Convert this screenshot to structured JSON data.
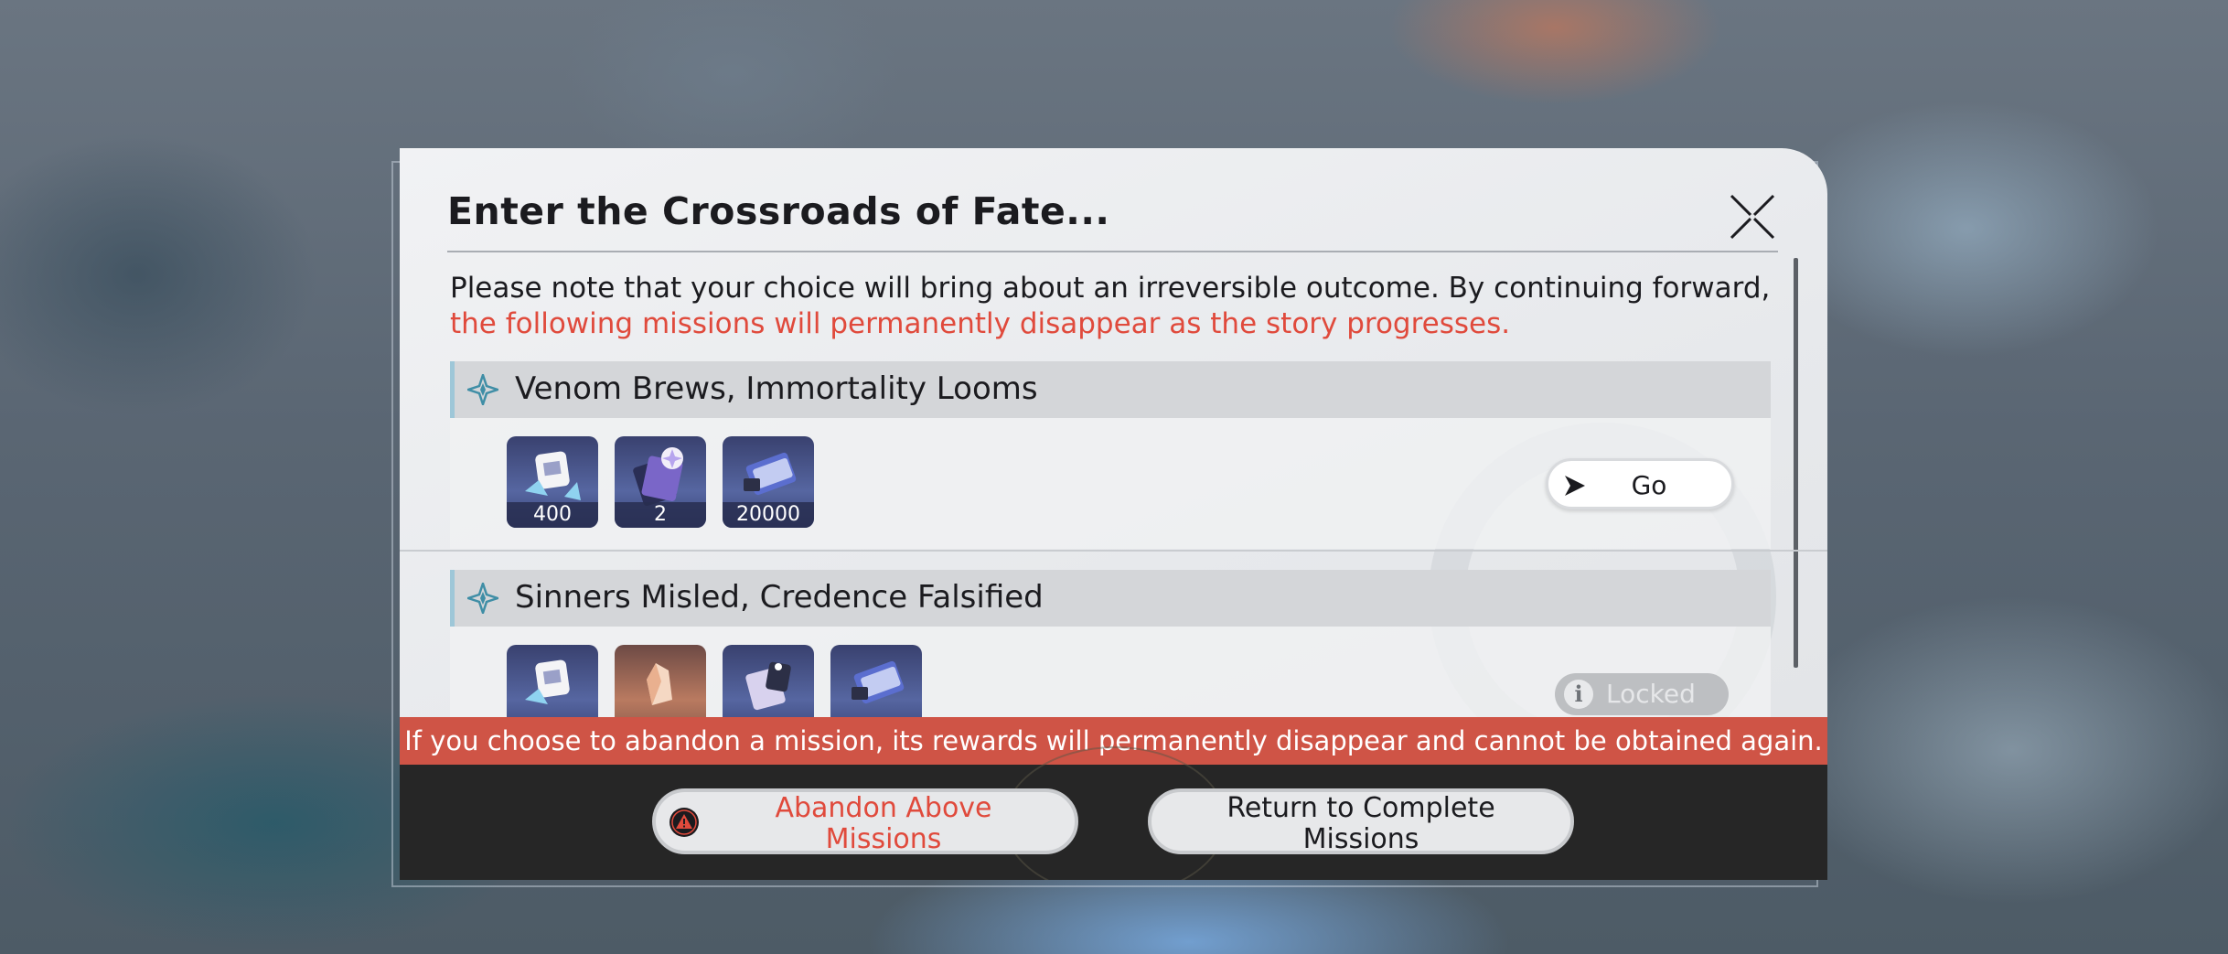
{
  "dialog": {
    "title": "Enter the Crossroads of Fate...",
    "note_line1": "Please note that your choice will bring about an irreversible outcome. By continuing forward,",
    "note_line2": "the following missions will permanently disappear as the story progresses.",
    "warning_banner": "If you choose to abandon a mission, its rewards will permanently disappear and cannot be obtained again."
  },
  "missions": [
    {
      "name": "Venom Brews, Immortality Looms",
      "rewards": [
        {
          "icon": "stellar-jade-pass-icon",
          "qty": "400"
        },
        {
          "icon": "star-rail-pass-icon",
          "qty": "2"
        },
        {
          "icon": "credit-icon",
          "qty": "20000"
        }
      ],
      "action": "Go"
    },
    {
      "name": "Sinners Misled, Credence Falsified",
      "rewards": [
        {
          "icon": "stellar-jade-pass-icon"
        },
        {
          "icon": "crystal-shard-icon"
        },
        {
          "icon": "traveler-guide-icon"
        },
        {
          "icon": "credit-icon"
        }
      ],
      "action": "Locked"
    }
  ],
  "footer": {
    "abandon_line1": "Abandon Above",
    "abandon_line2": "Missions",
    "return_line1": "Return to Complete",
    "return_line2": "Missions"
  },
  "colors": {
    "warning_red": "#e04a3c",
    "banner_red": "#cf5446",
    "footer_dark": "#262626"
  }
}
